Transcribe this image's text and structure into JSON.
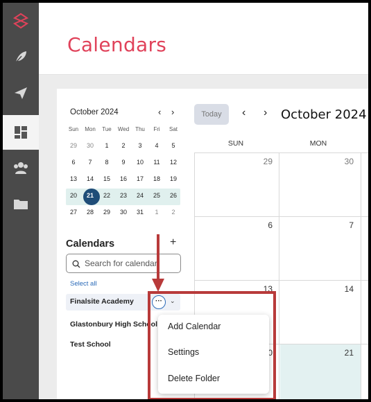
{
  "header": {
    "title": "Calendars"
  },
  "rail": {
    "items": [
      {
        "icon": "logo-icon"
      },
      {
        "icon": "feather-icon"
      },
      {
        "icon": "paper-plane-icon"
      },
      {
        "icon": "dashboard-icon",
        "active": true
      },
      {
        "icon": "group-icon"
      },
      {
        "icon": "folder-icon"
      }
    ]
  },
  "mini_calendar": {
    "month_label": "October 2024",
    "prev": "‹",
    "next": "›",
    "weekdays": [
      "Sun",
      "Mon",
      "Tue",
      "Wed",
      "Thu",
      "Fri",
      "Sat"
    ],
    "weeks": [
      [
        "29",
        "30",
        "1",
        "2",
        "3",
        "4",
        "5"
      ],
      [
        "6",
        "7",
        "8",
        "9",
        "10",
        "11",
        "12"
      ],
      [
        "13",
        "14",
        "15",
        "16",
        "17",
        "18",
        "19"
      ],
      [
        "20",
        "21",
        "22",
        "23",
        "24",
        "25",
        "26"
      ],
      [
        "27",
        "28",
        "29",
        "30",
        "31",
        "1",
        "2"
      ]
    ],
    "selected": "21"
  },
  "calendars_panel": {
    "heading": "Calendars",
    "add_label": "+",
    "search_placeholder": "Search for calendar",
    "select_all": "Select all",
    "folder": {
      "name": "Finalsite Academy",
      "more_label": "···",
      "expand_label": "⌄"
    },
    "items": [
      "Glastonbury High School",
      "Test School"
    ]
  },
  "main_calendar": {
    "today_label": "Today",
    "prev_arrow": "‹",
    "next_arrow": "›",
    "month_label": "October 2024",
    "day_headers": [
      "SUN",
      "MON"
    ],
    "rows": [
      [
        "29",
        "30"
      ],
      [
        "6",
        "7"
      ],
      [
        "13",
        "14"
      ],
      [
        "20",
        "21"
      ]
    ],
    "today": "21"
  },
  "folder_menu": {
    "items": [
      "Add Calendar",
      "Settings",
      "Delete Folder"
    ]
  },
  "colors": {
    "brand": "#e0425a",
    "rail": "#4a4a4a",
    "selected_day": "#1f4d78",
    "week_highlight": "#e0f0ee",
    "link": "#2a6ab8",
    "annotation": "#b83a3a"
  }
}
